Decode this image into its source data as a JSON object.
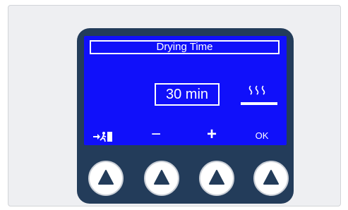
{
  "screen": {
    "title": "Drying Time",
    "value": "30 min",
    "mode_icon": "heat-waves-icon"
  },
  "softkeys": {
    "exit_icon": "exit-icon",
    "minus_label": "−",
    "plus_label": "+",
    "ok_label": "OK"
  },
  "buttons": [
    {
      "icon": "triangle-up-icon"
    },
    {
      "icon": "triangle-up-icon"
    },
    {
      "icon": "triangle-up-icon"
    },
    {
      "icon": "triangle-up-icon"
    }
  ],
  "colors": {
    "screen_background": "#1010fa",
    "device_body": "#233c5a",
    "foreground": "#ffffff"
  }
}
